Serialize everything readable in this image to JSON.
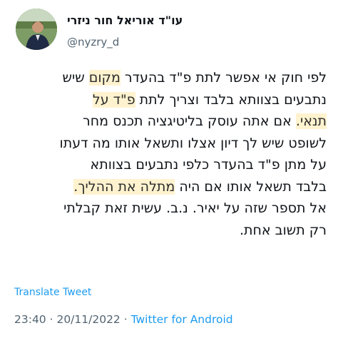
{
  "author": {
    "display_name": "עו\"ד אוריאל חור ניזרי",
    "handle": "@nyzry_d",
    "avatar_icon": "profile-photo"
  },
  "tweet": {
    "lines": [
      [
        {
          "text": "לפי חוק אי אפשר לתת פ\"ד בהעדר ",
          "highlight": false
        },
        {
          "text": "מקום",
          "highlight": true
        },
        {
          "text": " שיש",
          "highlight": false
        }
      ],
      [
        {
          "text": "נתבעים בצוותא בלבד וצריך לתת ",
          "highlight": false
        },
        {
          "text": "פ\"ד על",
          "highlight": true
        }
      ],
      [
        {
          "text": "תנאי.",
          "highlight": true
        },
        {
          "text": " אם אתה עוסק בליטיגציה תכנס מחר",
          "highlight": false
        }
      ],
      [
        {
          "text": "לשופט שיש לך דיון אצלו ותשאל אותו מה דעתו",
          "highlight": false
        }
      ],
      [
        {
          "text": "על מתן פ\"ד בהעדר כלפי נתבעים בצוותא",
          "highlight": false
        }
      ],
      [
        {
          "text": "בלבד תשאל אותו אם היה ",
          "highlight": false
        },
        {
          "text": "מתלה את ההליך.",
          "highlight": true
        }
      ],
      [
        {
          "text": "אל תספר שזה על יאיר. נ.ב. עשית זאת קבלתי",
          "highlight": false
        }
      ],
      [
        {
          "text": "רק תשוב אחת.",
          "highlight": false
        }
      ]
    ],
    "translate_label": "Translate Tweet",
    "time": "23:40",
    "separator": " · ",
    "date": "20/11/2022",
    "source": "Twitter for Android"
  },
  "colors": {
    "text": "#0f1419",
    "secondary": "#536471",
    "link": "#1d9bf0",
    "highlight": "#fff3cf"
  }
}
